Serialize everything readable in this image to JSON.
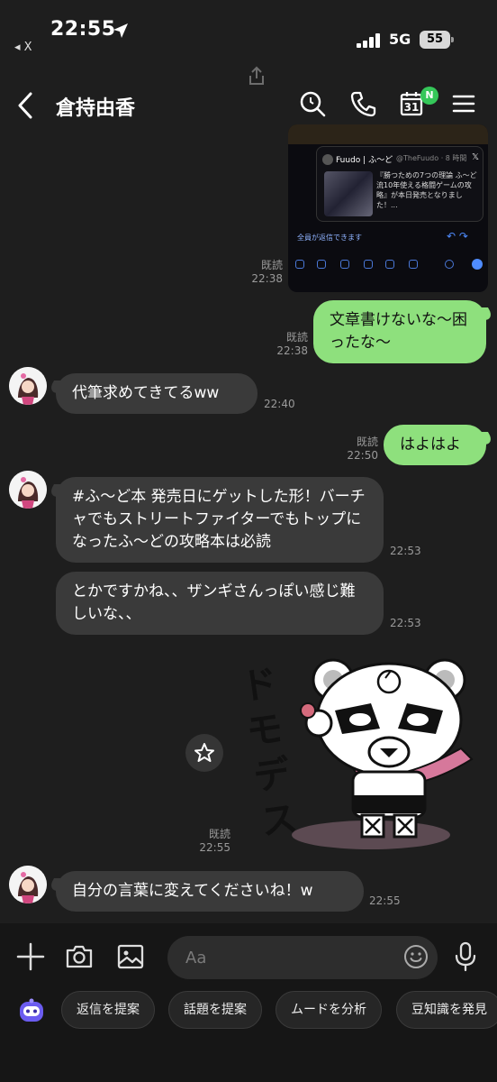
{
  "status": {
    "time": "22:55",
    "back_app": "◂ X",
    "network": "5G",
    "battery": "55"
  },
  "header": {
    "title": "倉持由香",
    "calendar_day": "31",
    "calendar_badge": "N",
    "icons": [
      "back-chevron-icon",
      "search-icon",
      "phone-icon",
      "calendar-icon",
      "menu-icon"
    ]
  },
  "screenshot_message": {
    "author_name": "Fuudo | ふ〜ど",
    "author_handle": "@TheFuudo · 8 時間",
    "tweet_text": "『勝つための7つの理論 ふ〜ど流10年使える格闘ゲームの攻略』が本日発売となりました！...",
    "reply_setting": "全員が返信できます",
    "read": "既読",
    "time": "22:38"
  },
  "messages": [
    {
      "id": "m1",
      "side": "out",
      "text": "文章書けないな〜困ったな〜",
      "read": "既読",
      "time": "22:38"
    },
    {
      "id": "m2",
      "side": "in",
      "text": "代筆求めてきてるww",
      "time": "22:40"
    },
    {
      "id": "m3",
      "side": "out",
      "text": "はよはよ",
      "read": "既読",
      "time": "22:50"
    },
    {
      "id": "m4",
      "side": "in",
      "text": "#ふ〜ど本 発売日にゲットした形！バーチャでもストリートファイターでもトップになったふ〜どの攻略本は必読",
      "time": "22:53"
    },
    {
      "id": "m5",
      "side": "in",
      "text": "とかですかね、、ザンギさんっぽい感じ難しいな、、",
      "time": "22:53"
    },
    {
      "id": "m6",
      "side": "out",
      "type": "sticker",
      "sticker_text": "ドモデス",
      "read": "既読",
      "time": "22:55"
    },
    {
      "id": "m7",
      "side": "in",
      "text": "自分の言葉に変えてくださいね！w",
      "time": "22:55"
    }
  ],
  "input_bar": {
    "placeholder": "Aa",
    "icons": [
      "plus-icon",
      "camera-icon",
      "image-icon",
      "emoji-icon",
      "microphone-icon"
    ]
  },
  "suggestions": [
    "返信を提案",
    "話題を提案",
    "ムードを分析",
    "豆知識を発見"
  ],
  "colors": {
    "background": "#1e1e1e",
    "outgoing_bubble": "#8ee07d",
    "incoming_bubble": "#3a3a3a",
    "badge": "#35c759"
  }
}
